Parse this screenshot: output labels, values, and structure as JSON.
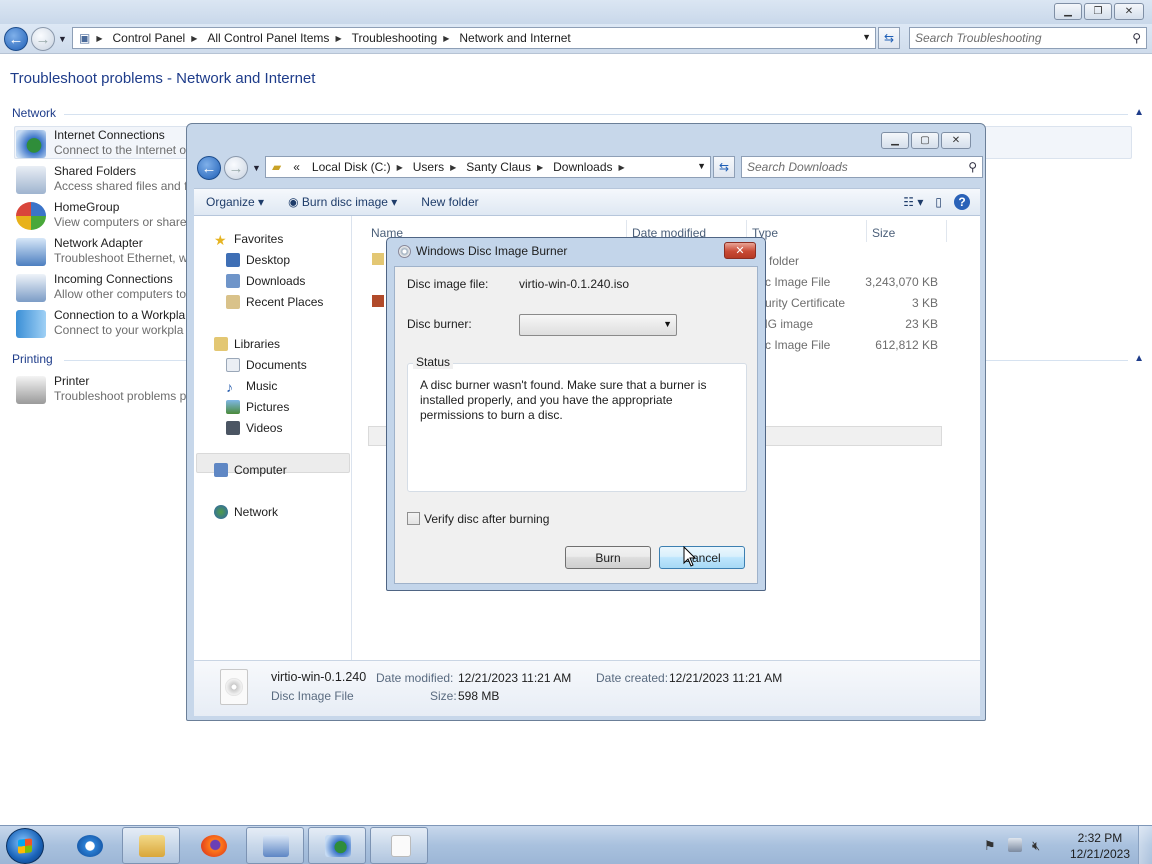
{
  "control_panel": {
    "breadcrumbs": [
      "Control Panel",
      "All Control Panel Items",
      "Troubleshooting",
      "Network and Internet"
    ],
    "search_placeholder": "Search Troubleshooting",
    "title": "Troubleshoot problems - Network and Internet",
    "sections": {
      "network": "Network",
      "printing": "Printing"
    },
    "items": [
      {
        "title": "Internet Connections",
        "desc": "Connect to the Internet o"
      },
      {
        "title": "Shared Folders",
        "desc": "Access shared files and fo"
      },
      {
        "title": "HomeGroup",
        "desc": "View computers or shared"
      },
      {
        "title": "Network Adapter",
        "desc": "Troubleshoot Ethernet, w"
      },
      {
        "title": "Incoming Connections",
        "desc": "Allow other computers to"
      },
      {
        "title": "Connection to a Workpla",
        "desc": "Connect to your workpla"
      },
      {
        "title": "Printer",
        "desc": "Troubleshoot problems p"
      }
    ]
  },
  "explorer": {
    "breadcrumbs": [
      "«",
      "Local Disk (C:)",
      "Users",
      "Santy Claus",
      "Downloads"
    ],
    "search_placeholder": "Search Downloads",
    "toolbar": {
      "organize": "Organize",
      "burn": "Burn disc image",
      "new_folder": "New folder"
    },
    "nav": {
      "favorites": "Favorites",
      "desktop": "Desktop",
      "downloads": "Downloads",
      "recent": "Recent Places",
      "libraries": "Libraries",
      "documents": "Documents",
      "music": "Music",
      "pictures": "Pictures",
      "videos": "Videos",
      "computer": "Computer",
      "network": "Network"
    },
    "columns": {
      "name": "Name",
      "date": "Date modified",
      "type": "Type",
      "size": "Size"
    },
    "files": [
      {
        "type": "e folder",
        "size": ""
      },
      {
        "type": "sc Image File",
        "size": "3,243,070 KB"
      },
      {
        "type": "curity Certificate",
        "size": "3 KB"
      },
      {
        "type": "NG image",
        "size": "23 KB"
      },
      {
        "type": "sc Image File",
        "size": "612,812 KB"
      }
    ],
    "details": {
      "name": "virtio-win-0.1.240",
      "kind": "Disc Image File",
      "date_modified_label": "Date modified:",
      "date_modified": "12/21/2023 11:21 AM",
      "size_label": "Size:",
      "size": "598 MB",
      "date_created_label": "Date created:",
      "date_created": "12/21/2023 11:21 AM"
    }
  },
  "dialog": {
    "title": "Windows Disc Image Burner",
    "close": "✕",
    "disc_image_label": "Disc image file:",
    "disc_image_value": "virtio-win-0.1.240.iso",
    "burner_label": "Disc burner:",
    "burner_value": "",
    "status_label": "Status",
    "status_text": "A disc burner wasn't found. Make sure that a burner is installed properly, and you have the appropriate permissions to burn a disc.",
    "verify_label": "Verify disc after burning",
    "verify_checked": false,
    "burn_button": "Burn",
    "cancel_button": "Cancel"
  },
  "taskbar": {
    "time": "2:32 PM",
    "date": "12/21/2023"
  }
}
